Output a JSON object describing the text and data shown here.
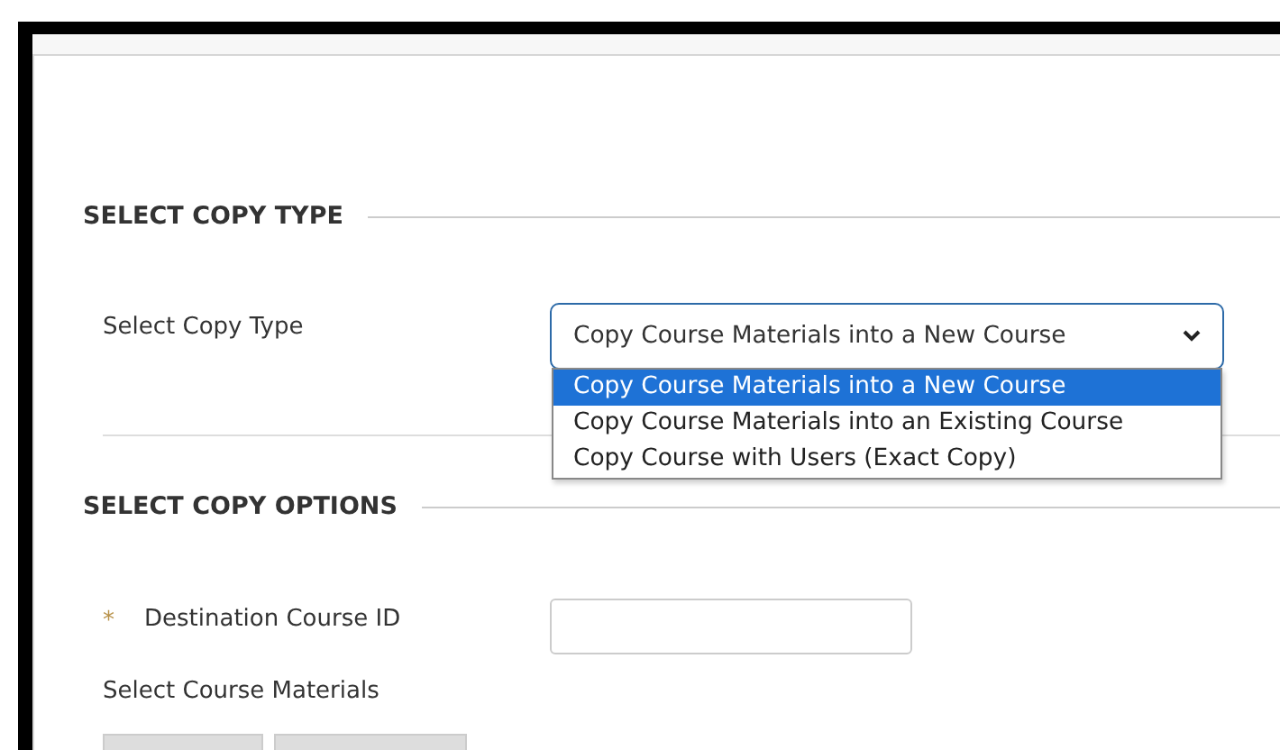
{
  "copy_type": {
    "heading": "SELECT COPY TYPE",
    "label": "Select Copy Type",
    "value": "Copy Course Materials into a New Course",
    "expanded": true,
    "options": [
      {
        "label": "Copy Course Materials into a New Course",
        "selected": true
      },
      {
        "label": "Copy Course Materials into an Existing Course",
        "selected": false
      },
      {
        "label": "Copy Course with Users (Exact Copy)",
        "selected": false
      }
    ]
  },
  "copy_options": {
    "heading": "SELECT COPY OPTIONS",
    "fields": [
      {
        "label": "Destination Course ID",
        "required": true,
        "required_mark": "*"
      }
    ],
    "materials_label": "Select Course Materials"
  }
}
